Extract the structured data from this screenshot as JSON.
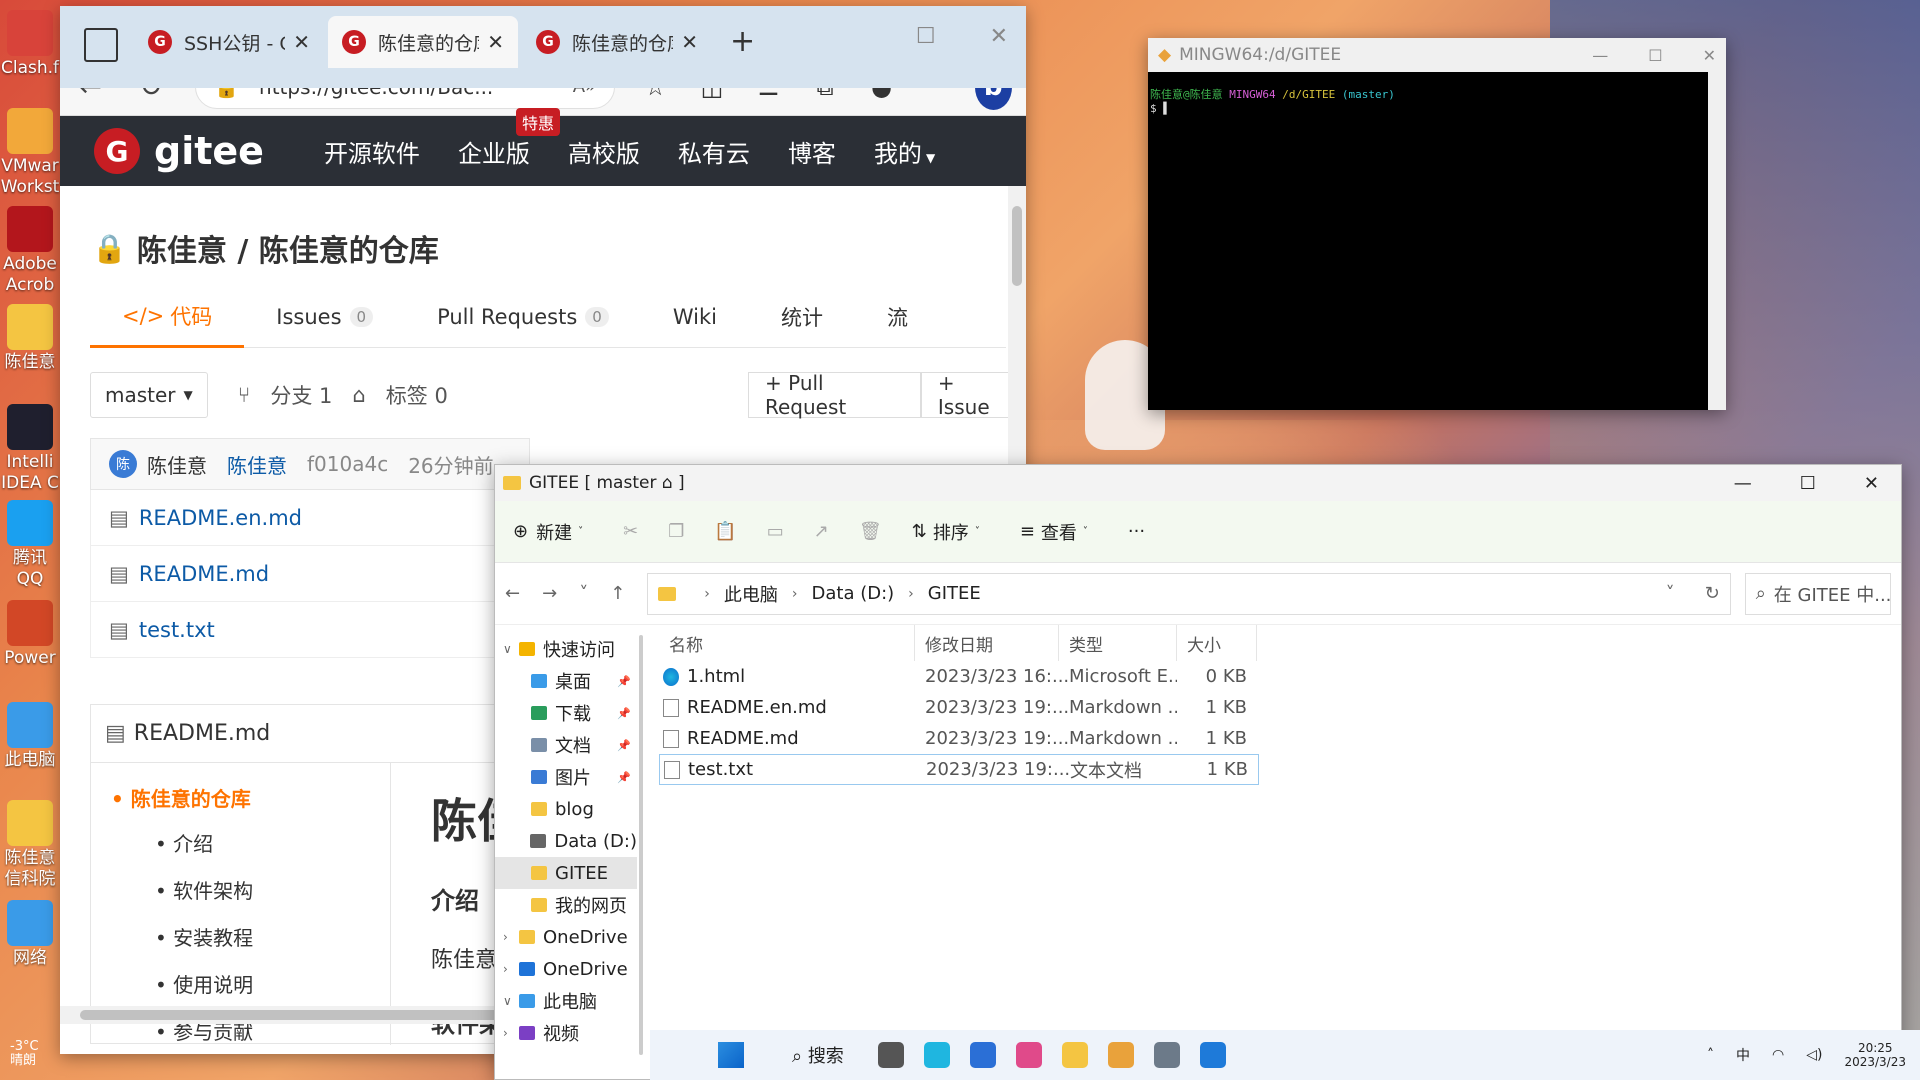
{
  "desktop": {
    "icons": [
      {
        "label": "Clash.f",
        "color": "#d8433a"
      },
      {
        "label": "VMwar Workst",
        "color": "#f2a83a"
      },
      {
        "label": "Adobe Acrob",
        "color": "#b3161c"
      },
      {
        "label": "陈佳意",
        "color": "#f4c542"
      },
      {
        "label": "Intelli IDEA C",
        "color": "#1f1f2e"
      },
      {
        "label": "腾讯QQ",
        "color": "#1aa0f0"
      },
      {
        "label": "Power",
        "color": "#d24726"
      },
      {
        "label": "此电脑",
        "color": "#3a9be8"
      },
      {
        "label": "陈佳意 信科院",
        "color": "#f4c542"
      },
      {
        "label": "网络",
        "color": "#3a9be8"
      }
    ],
    "weather": {
      "temp": "-3°C",
      "desc": "晴朗"
    }
  },
  "browser": {
    "tabs": [
      {
        "title": "SSH公钥 - Gi",
        "active": false
      },
      {
        "title": "陈佳意的仓库",
        "active": true
      },
      {
        "title": "陈佳意的仓库",
        "active": false
      }
    ],
    "url": "https://gitee.com/Bac...",
    "gitee": {
      "logo": "gitee",
      "nav": [
        "开源软件",
        "企业版",
        "高校版",
        "私有云",
        "博客",
        "我的"
      ],
      "hot_badge": "特惠",
      "repo_title": "陈佳意 / 陈佳意的仓库",
      "tabs": [
        {
          "label": "代码",
          "icon": "</>",
          "count": null,
          "active": true
        },
        {
          "label": "Issues",
          "count": "0"
        },
        {
          "label": "Pull Requests",
          "count": "0"
        },
        {
          "label": "Wiki",
          "count": null
        },
        {
          "label": "统计",
          "count": null
        },
        {
          "label": "流",
          "count": null
        }
      ],
      "branch": "master",
      "branch_count": "分支 1",
      "tag_count": "标签 0",
      "pull_request_btn": "+ Pull Request",
      "issue_btn": "+ Issue",
      "commit": {
        "avatar": "陈",
        "author": "陈佳意",
        "committer": "陈佳意",
        "hash": "f010a4c",
        "time": "26分钟前"
      },
      "files": [
        "README.en.md",
        "README.md",
        "test.txt"
      ],
      "readme": {
        "title": "README.md",
        "toc_main": "陈佳意的仓库",
        "toc_items": [
          "介绍",
          "软件架构",
          "安装教程",
          "使用说明",
          "参与贡献"
        ],
        "h1": "陈佳",
        "h2": "介绍",
        "p": "陈佳意",
        "h2b": "软件架"
      }
    }
  },
  "terminal": {
    "title": "MINGW64:/d/GITEE",
    "prompt_user": "陈佳意@陈佳意",
    "prompt_env": "MINGW64",
    "prompt_path": "/d/GITEE",
    "prompt_branch": "(master)",
    "dollar": "$"
  },
  "explorer": {
    "title": "GITEE [ master ⌂ ]",
    "toolbar": {
      "new": "新建",
      "sort": "排序",
      "view": "查看",
      "more": "···"
    },
    "path": [
      "此电脑",
      "Data (D:)",
      "GITEE"
    ],
    "search_placeholder": "在 GITEE 中...",
    "tree": [
      {
        "label": "快速访问",
        "color": "#f4b400",
        "chev": "∨",
        "pinned": false
      },
      {
        "label": "桌面",
        "color": "#3a9be8",
        "chev": "",
        "pinned": true
      },
      {
        "label": "下载",
        "color": "#2a9d5c",
        "chev": "",
        "pinned": true
      },
      {
        "label": "文档",
        "color": "#7a8fa8",
        "chev": "",
        "pinned": true
      },
      {
        "label": "图片",
        "color": "#3a7bd5",
        "chev": "",
        "pinned": true
      },
      {
        "label": "blog",
        "color": "#f4c542",
        "chev": "",
        "pinned": false
      },
      {
        "label": "Data (D:)",
        "color": "#666666",
        "chev": "",
        "pinned": false
      },
      {
        "label": "GITEE",
        "color": "#f4c542",
        "chev": "",
        "pinned": false,
        "selected": true
      },
      {
        "label": "我的网页",
        "color": "#f4c542",
        "chev": "",
        "pinned": false
      },
      {
        "label": "OneDrive",
        "color": "#f4c542",
        "chev": "›",
        "pinned": false
      },
      {
        "label": "OneDrive",
        "color": "#1e73d8",
        "chev": "›",
        "pinned": false
      },
      {
        "label": "此电脑",
        "color": "#3a9be8",
        "chev": "∨",
        "pinned": false
      },
      {
        "label": "视频",
        "color": "#7b3fc4",
        "chev": "›",
        "pinned": false
      }
    ],
    "columns": [
      "名称",
      "修改日期",
      "类型",
      "大小"
    ],
    "files": [
      {
        "name": "1.html",
        "date": "2023/3/23 16:...",
        "type": "Microsoft E...",
        "size": "0 KB",
        "icon": "edge"
      },
      {
        "name": "README.en.md",
        "date": "2023/3/23 19:...",
        "type": "Markdown ...",
        "size": "1 KB",
        "icon": "doc"
      },
      {
        "name": "README.md",
        "date": "2023/3/23 19:...",
        "type": "Markdown ...",
        "size": "1 KB",
        "icon": "doc"
      },
      {
        "name": "test.txt",
        "date": "2023/3/23 19:...",
        "type": "文本文档",
        "size": "1 KB",
        "icon": "txt",
        "selected": true
      }
    ]
  },
  "taskbar": {
    "search": "搜索",
    "apps": [
      "#555555",
      "#1fb6e0",
      "#2b6fd6",
      "#e04a8a",
      "#f4c542",
      "#e9a23b",
      "#6c7a89",
      "#1e7ad9"
    ],
    "ime": "中",
    "time": "20:25",
    "date": "2023/3/23"
  }
}
